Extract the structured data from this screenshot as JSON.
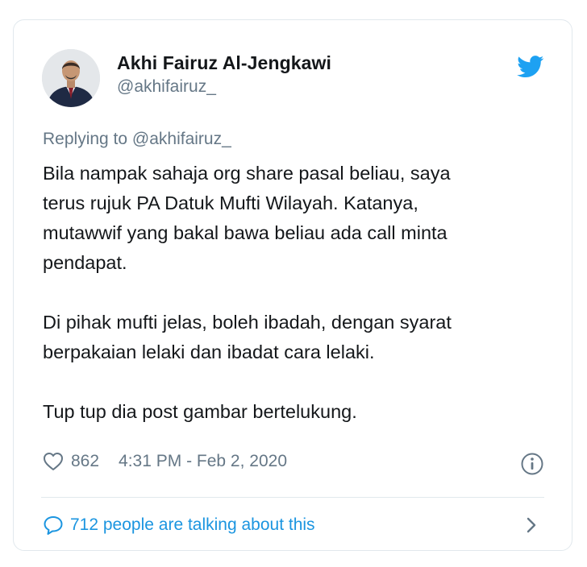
{
  "author": {
    "name": "Akhi Fairuz Al-Jengkawi",
    "handle": "@akhifairuz_"
  },
  "replying_to": "Replying to @akhifairuz_",
  "tweet": {
    "paragraphs": [
      "Bila nampak sahaja org share pasal beliau, saya\nterus rujuk PA Datuk Mufti Wilayah. Katanya,\nmutawwif yang bakal bawa beliau ada call minta\npendapat.",
      "Di pihak mufti jelas, boleh ibadah, dengan syarat\nberpakaian lelaki dan ibadat cara lelaki.",
      "Tup tup dia post gambar bertelukung."
    ]
  },
  "meta": {
    "like_count": "862",
    "timestamp": "4:31 PM - Feb 2, 2020"
  },
  "footer": {
    "talking_label": "712 people are talking about this"
  },
  "icons": {
    "brand": "twitter-bird-icon",
    "like": "heart-icon",
    "info": "info-icon",
    "conversation": "speech-bubble-icon",
    "more": "chevron-right-icon"
  },
  "colors": {
    "twitter_blue": "#1da1f2",
    "link_blue": "#1b95e0",
    "secondary_text": "#657786",
    "primary_text": "#14171a",
    "border": "#e1e8ed"
  }
}
